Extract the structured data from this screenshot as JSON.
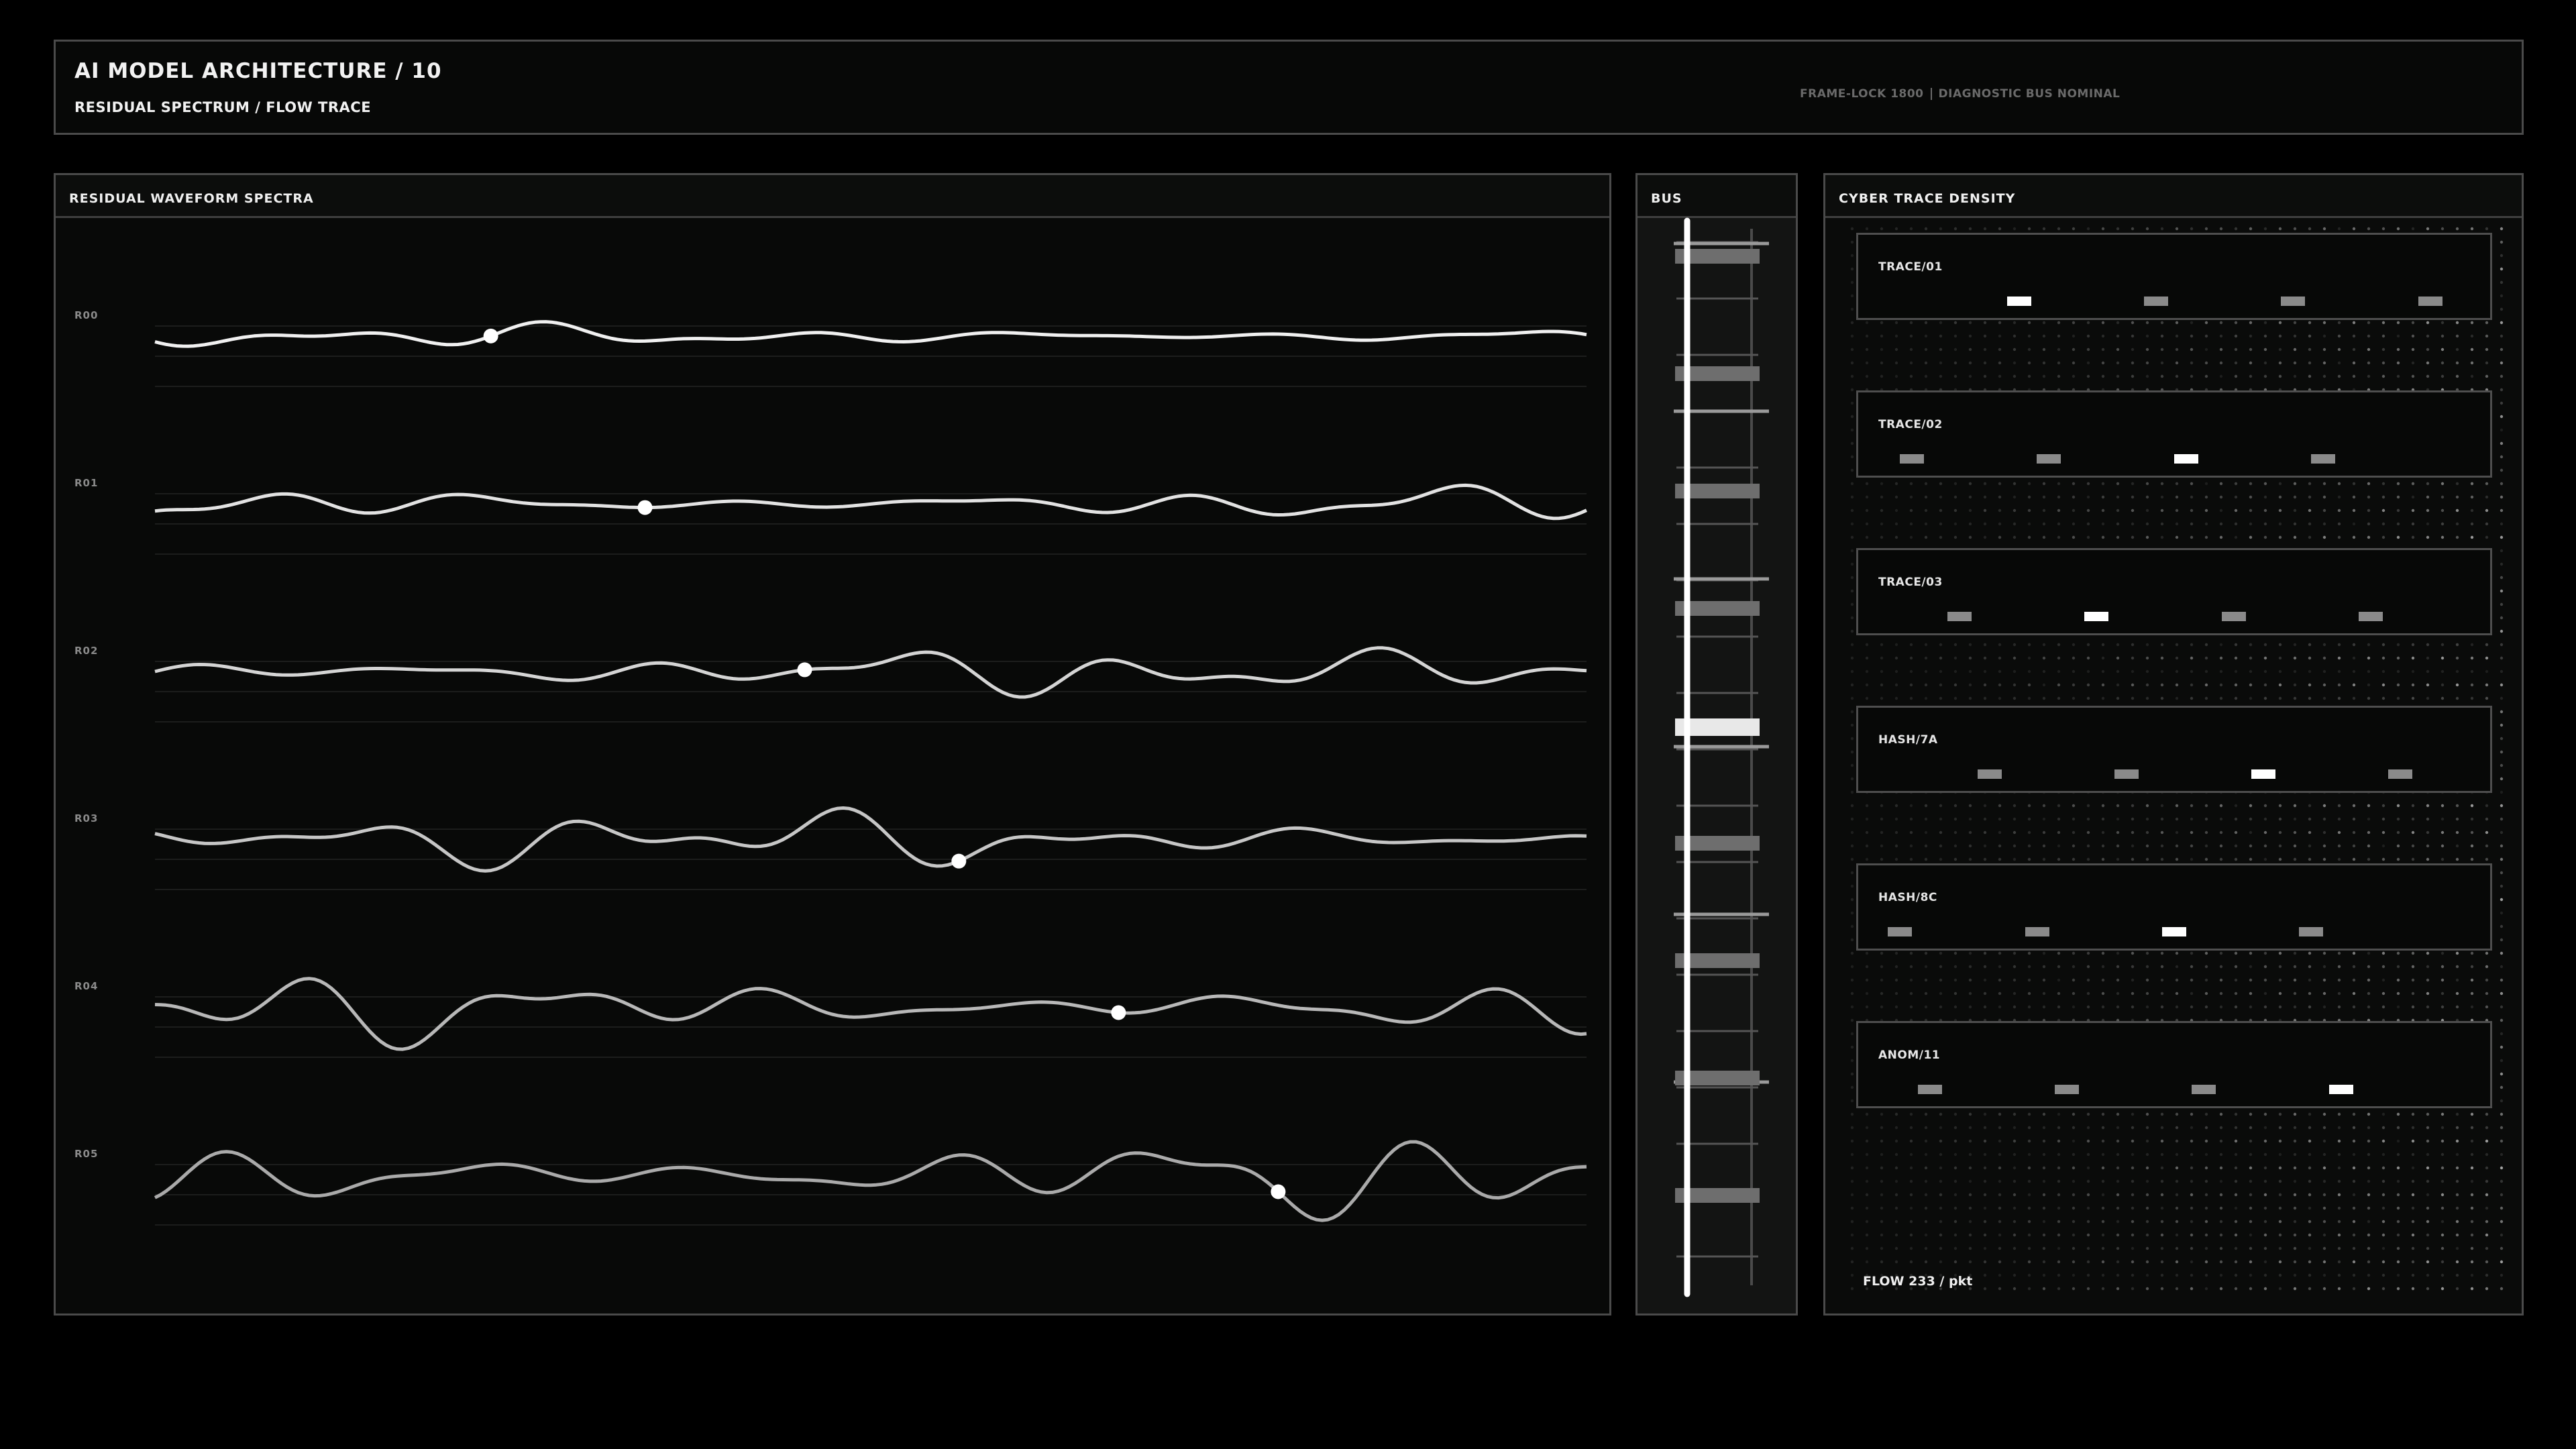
{
  "header": {
    "title": "AI MODEL ARCHITECTURE / 10",
    "subtitle": "RESIDUAL SPECTRUM / FLOW TRACE",
    "status_left": "FRAME-LOCK 1800",
    "status_right": "DIAGNOSTIC BUS NOMINAL"
  },
  "spectra": {
    "title": "RESIDUAL WAVEFORM SPECTRA",
    "rows": [
      {
        "label": "R00",
        "marker": 0.233
      },
      {
        "label": "R01",
        "marker": 0.343
      },
      {
        "label": "R02",
        "marker": 0.453
      },
      {
        "label": "R03",
        "marker": 0.563
      },
      {
        "label": "R04",
        "marker": 0.673
      },
      {
        "label": "R05",
        "marker": 0.783
      }
    ]
  },
  "bus": {
    "title": "BUS",
    "highlight_index": 4,
    "block_count": 9
  },
  "density": {
    "title": "CYBER TRACE DENSITY",
    "traces": [
      {
        "label": "TRACE/01",
        "ticks": [
          0.25,
          0.48,
          0.71,
          0.94
        ],
        "highlight": 0
      },
      {
        "label": "TRACE/02",
        "ticks": [
          0.07,
          0.3,
          0.53,
          0.76
        ],
        "highlight": 2
      },
      {
        "label": "TRACE/03",
        "ticks": [
          0.15,
          0.38,
          0.61,
          0.84
        ],
        "highlight": 1
      },
      {
        "label": "HASH/7A",
        "ticks": [
          0.2,
          0.43,
          0.66,
          0.89
        ],
        "highlight": 2
      },
      {
        "label": "HASH/8C",
        "ticks": [
          0.05,
          0.28,
          0.51,
          0.74
        ],
        "highlight": 2
      },
      {
        "label": "ANOM/11",
        "ticks": [
          0.1,
          0.33,
          0.56,
          0.79
        ],
        "highlight": 3
      }
    ],
    "flow_label": "FLOW 233 / pkt"
  },
  "colors": {
    "background": "#000000",
    "panel": "#080908",
    "border": "#4a4a4a",
    "accent": "#ffffff",
    "muted": "#8a8a8a"
  }
}
